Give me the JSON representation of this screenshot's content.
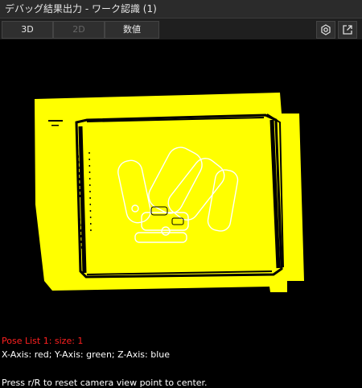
{
  "window": {
    "title": "デバッグ結果出力 - ワーク認識 (1)"
  },
  "toolbar": {
    "tabs": [
      {
        "label": "3D",
        "enabled": true
      },
      {
        "label": "2D",
        "enabled": false
      },
      {
        "label": "数値",
        "enabled": true
      }
    ],
    "icons": [
      "settings-icon",
      "external-link-icon"
    ]
  },
  "viewport": {
    "pose_list": "Pose List 1: size: 1",
    "axis_legend": "X-Axis: red; Y-Axis: green; Z-Axis: blue",
    "reset_hint": "Press r/R to reset camera view point to center.",
    "colors": {
      "pose_text": "#ff2020",
      "pointcloud": "#ffff00",
      "background": "#000000"
    }
  }
}
